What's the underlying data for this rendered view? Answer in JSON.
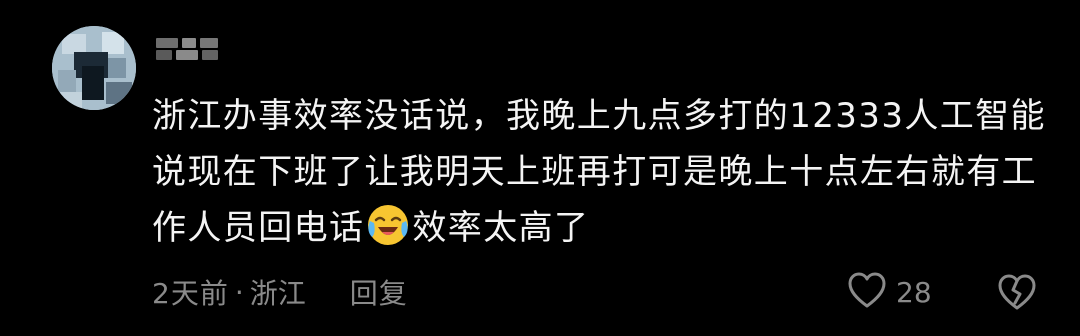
{
  "comment": {
    "avatar": "avatar-image",
    "username": "",
    "text_part1": "浙江办事效率没话说，我晚上九点多打的12333人工智能说现在下班了让我明天上班再打可是晚上十点左右就有工作人员回电话",
    "emoji": "crying-laughing-emoji",
    "text_part2": "效率太高了",
    "time": "2天前",
    "separator": "·",
    "location": "浙江",
    "reply_label": "回复",
    "like_icon": "heart-outline-icon",
    "like_count": "28",
    "dislike_icon": "broken-heart-icon"
  },
  "colors": {
    "background": "#000000",
    "text": "#f4f4f4",
    "meta": "#8a8a8a"
  }
}
